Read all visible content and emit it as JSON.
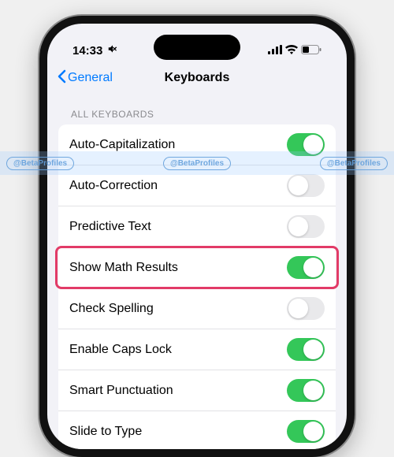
{
  "status": {
    "time": "14:33",
    "silent_icon": "🔕"
  },
  "nav": {
    "back_label": "General",
    "title": "Keyboards"
  },
  "section": {
    "header": "ALL KEYBOARDS"
  },
  "rows": [
    {
      "label": "Auto-Capitalization",
      "on": true,
      "highlighted": false
    },
    {
      "label": "Auto-Correction",
      "on": false,
      "highlighted": false
    },
    {
      "label": "Predictive Text",
      "on": false,
      "highlighted": false
    },
    {
      "label": "Show Math Results",
      "on": true,
      "highlighted": true
    },
    {
      "label": "Check Spelling",
      "on": false,
      "highlighted": false
    },
    {
      "label": "Enable Caps Lock",
      "on": true,
      "highlighted": false
    },
    {
      "label": "Smart Punctuation",
      "on": true,
      "highlighted": false
    },
    {
      "label": "Slide to Type",
      "on": true,
      "highlighted": false
    }
  ],
  "watermark": {
    "text": "@BetaProfiles"
  },
  "colors": {
    "accent": "#007aff",
    "toggle_on": "#34c759",
    "highlight": "#e23b67"
  }
}
